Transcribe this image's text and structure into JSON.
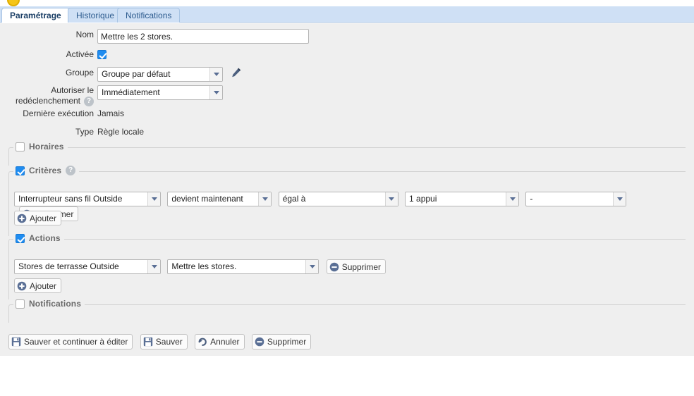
{
  "window": {
    "scenario_icon": "yellow-circle-icon"
  },
  "tabs": [
    {
      "label": "Paramétrage",
      "active": true
    },
    {
      "label": "Historique",
      "active": false
    },
    {
      "label": "Notifications",
      "active": false
    }
  ],
  "form": {
    "nom": {
      "label": "Nom",
      "value": "Mettre les 2 stores."
    },
    "activee": {
      "label": "Activée",
      "checked": true
    },
    "groupe": {
      "label": "Groupe",
      "value": "Groupe par défaut",
      "edit_icon": "pencil-icon"
    },
    "redeclenchement": {
      "label_line1": "Autoriser le",
      "label_line2": "redéclenchement",
      "value": "Immédiatement",
      "help_icon": "question-mark-icon",
      "help_glyph": "?"
    },
    "derniere_execution": {
      "label": "Dernière exécution",
      "value": "Jamais"
    },
    "type": {
      "label": "Type",
      "value": "Règle locale"
    }
  },
  "sections": {
    "horaires": {
      "label": "Horaires",
      "checked": false
    },
    "criteres": {
      "label": "Critères",
      "checked": true,
      "help_icon": "question-mark-icon",
      "help_glyph": "?",
      "rows": [
        {
          "device": "Interrupteur sans fil Outside",
          "event": "devient maintenant",
          "operator": "égal à",
          "value": "1 appui",
          "extra": "-",
          "delete_label": "Supprimer"
        }
      ],
      "add_label": "Ajouter"
    },
    "actions": {
      "label": "Actions",
      "checked": true,
      "rows": [
        {
          "target": "Stores de terrasse Outside",
          "command": "Mettre les stores.",
          "delete_label": "Supprimer"
        }
      ],
      "add_label": "Ajouter"
    },
    "notifications": {
      "label": "Notifications",
      "checked": false
    }
  },
  "footer": {
    "save_continue": "Sauver et continuer à éditer",
    "save": "Sauver",
    "cancel": "Annuler",
    "delete": "Supprimer"
  },
  "colors": {
    "accent_blue": "#1f8cf0",
    "icon_slate": "#5a6f95",
    "tabbar_blue": "#cfe0f5",
    "panel_gray": "#efefef",
    "scenario_icon": "#f5c518"
  }
}
